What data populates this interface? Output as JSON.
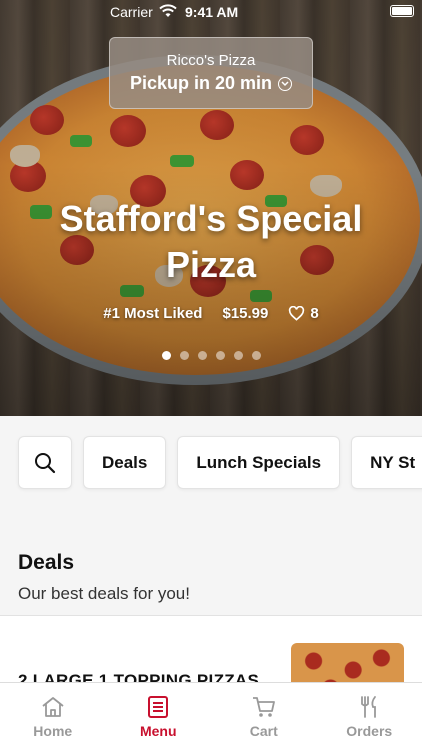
{
  "status_bar": {
    "carrier": "Carrier",
    "time": "9:41 AM"
  },
  "store": {
    "name": "Ricco's Pizza",
    "pickup": "Pickup in 20 min"
  },
  "hero": {
    "title_line1": "Stafford's Special",
    "title_line2": "Pizza",
    "rank": "#1 Most Liked",
    "price": "$15.99",
    "likes": "8",
    "slides_total": 6,
    "slide_active": 1
  },
  "categories": [
    {
      "label": "Deals"
    },
    {
      "label": "Lunch Specials"
    },
    {
      "label": "NY St"
    }
  ],
  "deals": {
    "title": "Deals",
    "subtitle": "Our best deals for you!",
    "items": [
      {
        "name": "2 LARGE 1 TOPPING PIZZAS"
      }
    ]
  },
  "tabs": [
    {
      "label": "Home",
      "icon": "home-icon"
    },
    {
      "label": "Menu",
      "icon": "menu-icon",
      "active": true
    },
    {
      "label": "Cart",
      "icon": "cart-icon"
    },
    {
      "label": "Orders",
      "icon": "orders-icon"
    }
  ],
  "colors": {
    "accent": "#c8102e",
    "tab_inactive": "#999999"
  }
}
